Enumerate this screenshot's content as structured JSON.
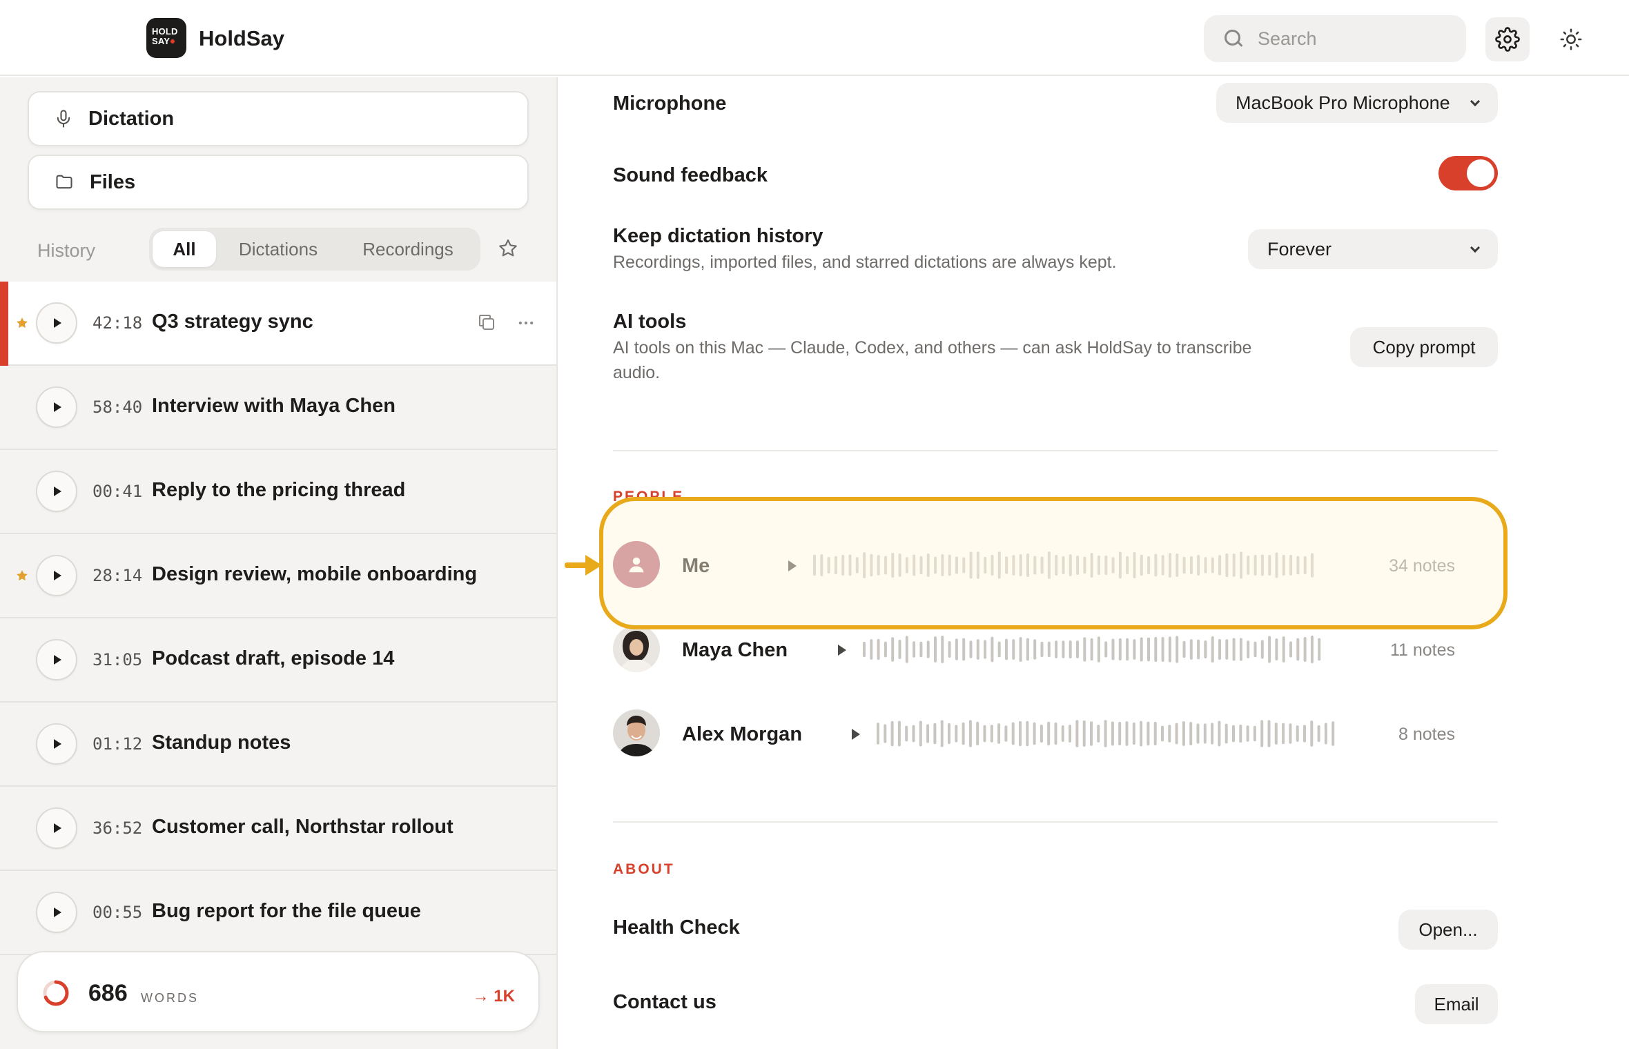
{
  "app": {
    "logo_line1": "HOLD",
    "logo_line2": "SAY",
    "name": "HoldSay"
  },
  "search": {
    "placeholder": "Search"
  },
  "sidebar": {
    "nav": [
      {
        "label": "Dictation",
        "icon": "microphone-icon"
      },
      {
        "label": "Files",
        "icon": "folder-icon"
      }
    ],
    "history_label": "History",
    "filters": [
      "All",
      "Dictations",
      "Recordings"
    ],
    "active_filter": "All",
    "items": [
      {
        "duration": "42:18",
        "title": "Q3 strategy sync",
        "starred": true,
        "selected": true
      },
      {
        "duration": "58:40",
        "title": "Interview with Maya Chen",
        "starred": false,
        "selected": false
      },
      {
        "duration": "00:41",
        "title": "Reply to the pricing thread",
        "starred": false,
        "selected": false
      },
      {
        "duration": "28:14",
        "title": "Design review, mobile onboarding",
        "starred": true,
        "selected": false
      },
      {
        "duration": "31:05",
        "title": "Podcast draft, episode 14",
        "starred": false,
        "selected": false
      },
      {
        "duration": "01:12",
        "title": "Standup notes",
        "starred": false,
        "selected": false
      },
      {
        "duration": "36:52",
        "title": "Customer call, Northstar rollout",
        "starred": false,
        "selected": false
      },
      {
        "duration": "00:55",
        "title": "Bug report for the file queue",
        "starred": false,
        "selected": false
      }
    ],
    "words": {
      "count": "686",
      "unit": "WORDS",
      "goal": "→ 1K",
      "progress": 0.686
    }
  },
  "settings": {
    "microphone": {
      "label": "Microphone",
      "value": "MacBook Pro Microphone"
    },
    "sound_feedback": {
      "label": "Sound feedback",
      "enabled": true
    },
    "history": {
      "label": "Keep dictation history",
      "description": "Recordings, imported files, and starred dictations are always kept.",
      "value": "Forever"
    },
    "ai_tools": {
      "label": "AI tools",
      "description_line1": "AI tools on this Mac — Claude, Codex, and others — can ask HoldSay to transcribe",
      "description_line2": "audio.",
      "button": "Copy prompt"
    }
  },
  "people": {
    "section_label": "PEOPLE",
    "list": [
      {
        "name": "Me",
        "notes": "34 notes"
      },
      {
        "name": "Maya Chen",
        "notes": "11 notes"
      },
      {
        "name": "Alex Morgan",
        "notes": "8 notes"
      }
    ]
  },
  "about": {
    "section_label": "ABOUT",
    "health_check": {
      "label": "Health Check",
      "button": "Open..."
    },
    "contact": {
      "label": "Contact us",
      "button": "Email"
    }
  },
  "colors": {
    "accent": "#d8402c",
    "highlight": "#e8a91a",
    "me_avatar": "#b75f75"
  }
}
